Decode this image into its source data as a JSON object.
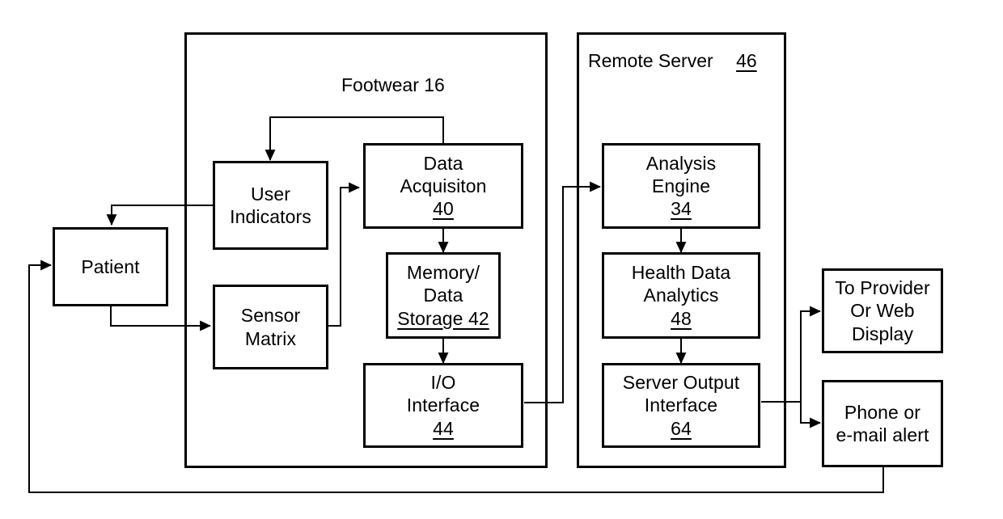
{
  "diagram": {
    "title": "Footwear health monitoring system block diagram",
    "background_color": "#ffffff",
    "line_color": "#000000"
  },
  "groups": [
    {
      "id": "footwear",
      "label": "Footwear 16",
      "label_text": "Footwear",
      "ref": "16"
    },
    {
      "id": "remote_server",
      "label": "Remote Server",
      "label_text": "Remote Server",
      "ref": "46"
    }
  ],
  "blocks": {
    "patient": {
      "name": "Patient",
      "lines": [
        "Patient"
      ],
      "ref": ""
    },
    "user_indicators": {
      "name": "User Indicators",
      "lines": [
        "User",
        "Indicators"
      ],
      "ref": ""
    },
    "sensor_matrix": {
      "name": "Sensor Matrix",
      "lines": [
        "Sensor",
        "Matrix"
      ],
      "ref": ""
    },
    "data_acquisition": {
      "name": "Data Acquisiton",
      "lines": [
        "Data",
        "Acquisiton"
      ],
      "ref": "40"
    },
    "memory_data_storage": {
      "name": "Memory/Data Storage",
      "lines": [
        "Memory/",
        "Data",
        "Storage 42"
      ],
      "ref": "42"
    },
    "io_interface": {
      "name": "I/O Interface",
      "lines": [
        "I/O",
        "Interface"
      ],
      "ref": "44"
    },
    "analysis_engine": {
      "name": "Analysis Engine",
      "lines": [
        "Analysis",
        "Engine"
      ],
      "ref": "34"
    },
    "health_data_analytics": {
      "name": "Health Data Analytics",
      "lines": [
        "Health Data",
        "Analytics"
      ],
      "ref": "48"
    },
    "server_output_interface": {
      "name": "Server Output Interface",
      "lines": [
        "Server Output",
        "Interface"
      ],
      "ref": "64"
    },
    "provider_web_display": {
      "name": "To Provider Or Web Display",
      "lines": [
        "To Provider",
        "Or Web",
        "Display"
      ],
      "ref": ""
    },
    "phone_email_alert": {
      "name": "Phone or e-mail alert",
      "lines": [
        "Phone or",
        "e-mail alert"
      ],
      "ref": ""
    }
  },
  "connections": [
    {
      "from": "data_acquisition",
      "to": "user_indicators",
      "style": "feedback-top"
    },
    {
      "from": "user_indicators",
      "to": "patient",
      "style": "elbow-down"
    },
    {
      "from": "patient",
      "to": "sensor_matrix",
      "style": "elbow-right"
    },
    {
      "from": "sensor_matrix",
      "to": "data_acquisition",
      "style": "elbow-up"
    },
    {
      "from": "data_acquisition",
      "to": "memory_data_storage",
      "style": "down"
    },
    {
      "from": "memory_data_storage",
      "to": "io_interface",
      "style": "down"
    },
    {
      "from": "io_interface",
      "to": "analysis_engine",
      "style": "elbow-up"
    },
    {
      "from": "analysis_engine",
      "to": "health_data_analytics",
      "style": "down"
    },
    {
      "from": "health_data_analytics",
      "to": "server_output_interface",
      "style": "down"
    },
    {
      "from": "server_output_interface",
      "to": "provider_web_display",
      "style": "elbow-up"
    },
    {
      "from": "server_output_interface",
      "to": "phone_email_alert",
      "style": "elbow-down"
    },
    {
      "from": "phone_email_alert",
      "to": "patient",
      "style": "feedback-bottom"
    }
  ]
}
